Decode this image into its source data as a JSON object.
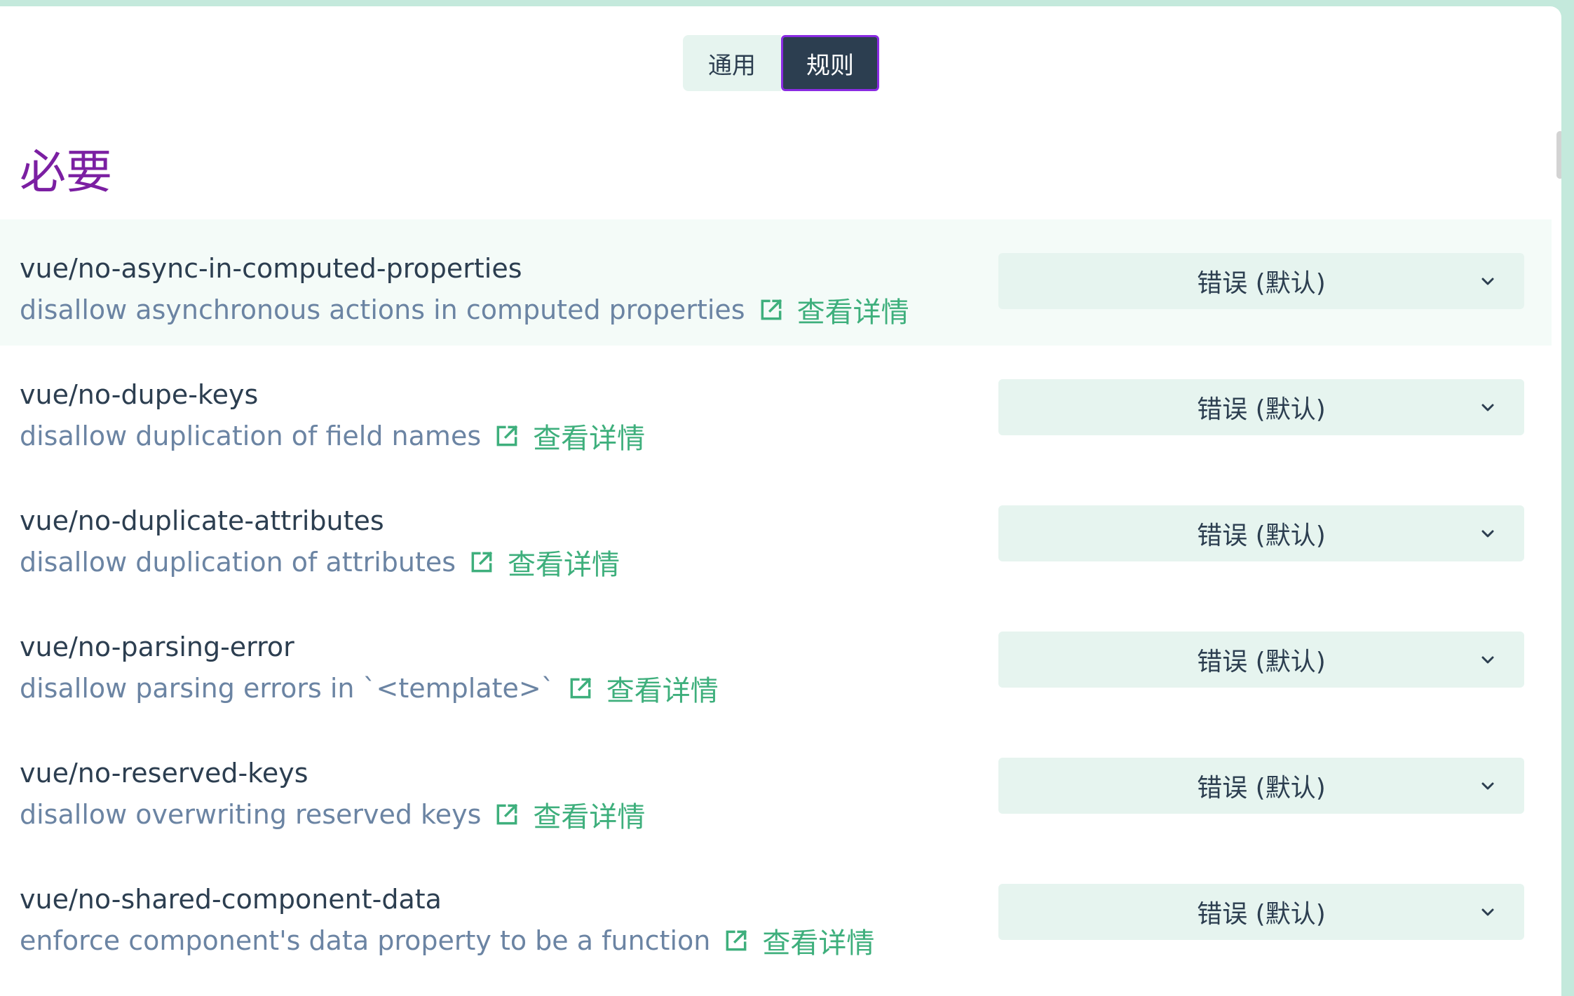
{
  "tabs": {
    "general": "通用",
    "rules": "规则"
  },
  "section": {
    "title": "必要"
  },
  "rules": [
    {
      "name": "vue/no-async-in-computed-properties",
      "description": "disallow asynchronous actions in computed properties",
      "link_label": "查看详情",
      "severity": "错误 (默认)"
    },
    {
      "name": "vue/no-dupe-keys",
      "description": "disallow duplication of field names",
      "link_label": "查看详情",
      "severity": "错误 (默认)"
    },
    {
      "name": "vue/no-duplicate-attributes",
      "description": "disallow duplication of attributes",
      "link_label": "查看详情",
      "severity": "错误 (默认)"
    },
    {
      "name": "vue/no-parsing-error",
      "description": "disallow parsing errors in `<template>`",
      "link_label": "查看详情",
      "severity": "错误 (默认)"
    },
    {
      "name": "vue/no-reserved-keys",
      "description": "disallow overwriting reserved keys",
      "link_label": "查看详情",
      "severity": "错误 (默认)"
    },
    {
      "name": "vue/no-shared-component-data",
      "description": "enforce component's data property to be a function",
      "link_label": "查看详情",
      "severity": "错误 (默认)"
    }
  ],
  "colors": {
    "accent_green": "#3eaf7c",
    "section_title_purple": "#7b1fa2",
    "active_tab_bg": "#2c3e50",
    "active_tab_border": "#8a2be2",
    "select_bg": "#e6f4ef",
    "description_text": "#6b84a3"
  },
  "icons": {
    "external_link": "external-link-icon",
    "dropdown": "chevron-down-icon"
  }
}
